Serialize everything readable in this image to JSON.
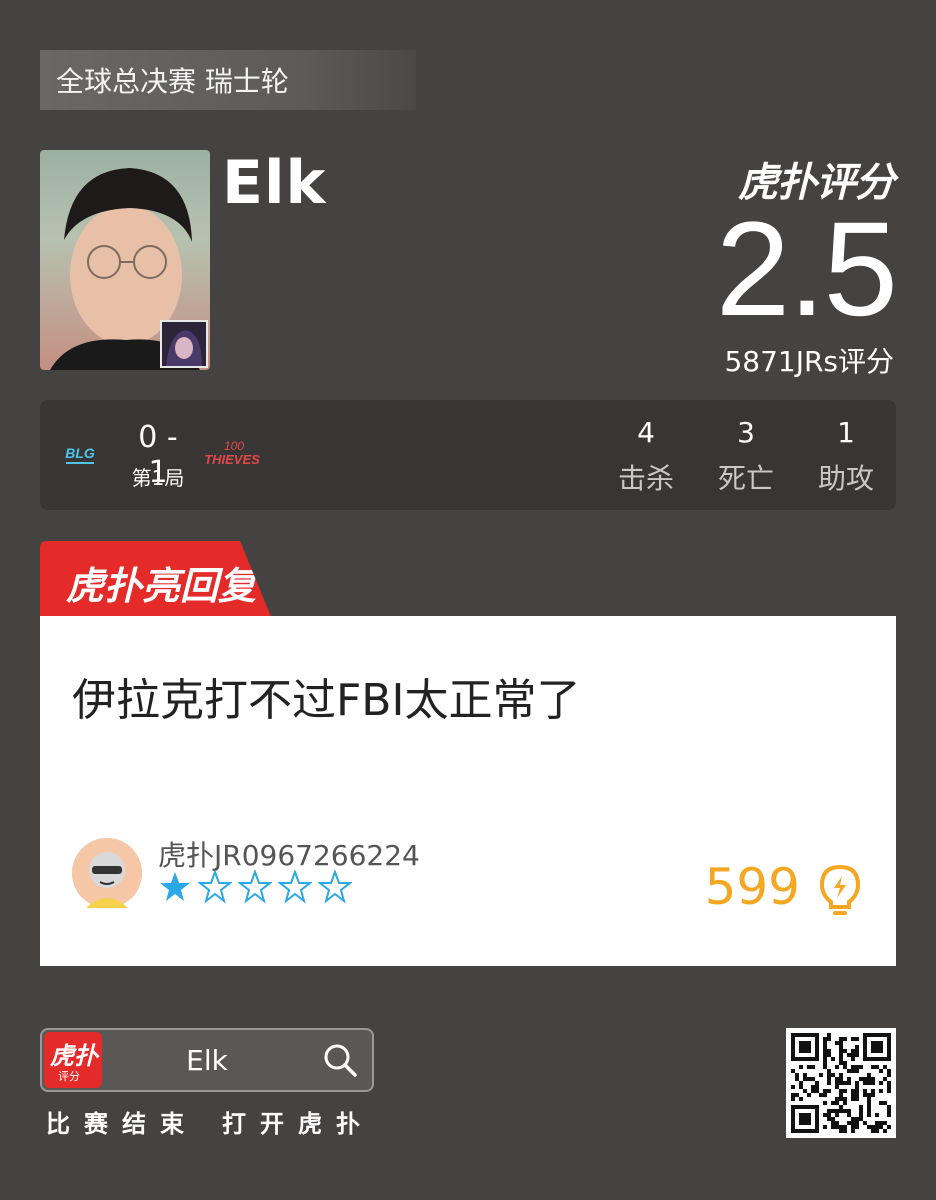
{
  "header": {
    "tag": "全球总决赛 瑞士轮"
  },
  "player": {
    "name": "Elk"
  },
  "rating": {
    "logo": "虎扑评分",
    "score": "2.5",
    "count": "5871JRs评分"
  },
  "match": {
    "score": "0 - 1",
    "game": "第1局",
    "stats": [
      {
        "value": "4",
        "label": "击杀"
      },
      {
        "value": "3",
        "label": "死亡"
      },
      {
        "value": "1",
        "label": "助攻"
      }
    ]
  },
  "reply": {
    "tab_label": "虎扑亮回复",
    "text": "伊拉克打不过FBI太正常了",
    "user": "虎扑JR0967266224",
    "stars_filled": 1,
    "stars_total": 5,
    "likes": "599"
  },
  "footer": {
    "app_icon_line1": "虎扑",
    "app_icon_line2": "评分",
    "search_text": "Elk",
    "left_caption": "比赛结束",
    "right_caption": "打开虎扑"
  },
  "colors": {
    "accent_red": "#e52a2a",
    "likes_orange": "#f5a623",
    "star_blue": "#2aa8e8"
  }
}
